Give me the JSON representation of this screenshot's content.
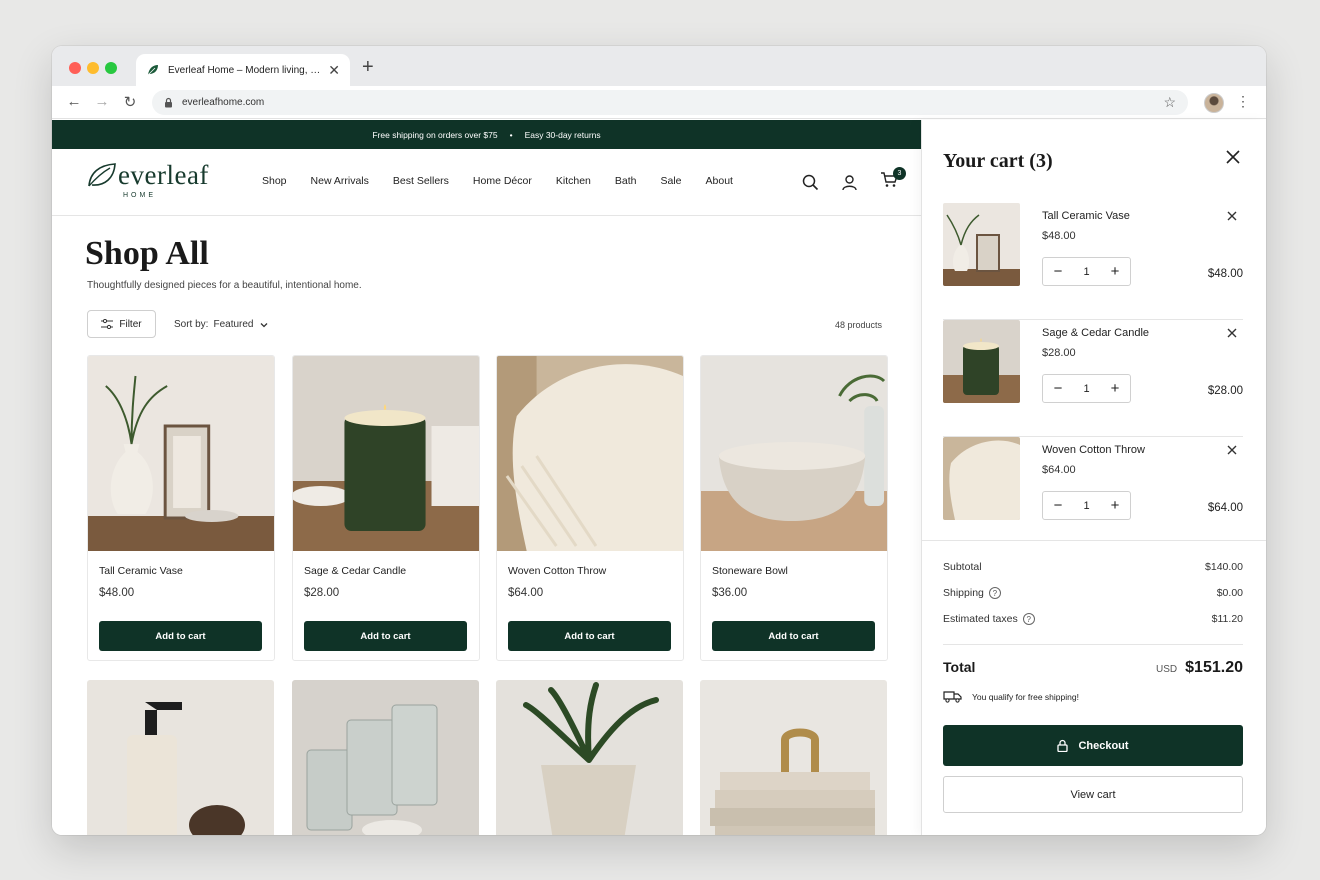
{
  "browser": {
    "tab_title": "Everleaf Home – Modern living, …",
    "url": "everleafhome.com",
    "icons": [
      "leaf-favicon",
      "close-icon",
      "plus-icon",
      "back-arrow-icon",
      "forward-arrow-icon",
      "reload-icon",
      "lock-icon",
      "star-icon",
      "avatar",
      "kebab-menu-icon"
    ]
  },
  "announcement": {
    "left": "Free shipping on orders over $75",
    "separator": "•",
    "right": "Easy 30-day returns"
  },
  "header": {
    "logo_word": "everleaf",
    "logo_sub": "HOME",
    "nav": [
      "Shop",
      "New Arrivals",
      "Best Sellers",
      "Home Décor",
      "Kitchen",
      "Bath",
      "Sale",
      "About"
    ],
    "cart_count": "3"
  },
  "catalog": {
    "title": "Shop All",
    "subtitle": "Thoughtfully designed pieces for a beautiful, intentional home.",
    "filter_label": "Filter",
    "sort_label": "Sort by:",
    "sort_value": "Featured",
    "product_count": "48 products",
    "add_label": "Add to cart",
    "products": [
      {
        "name": "Tall Ceramic Vase",
        "price": "$48.00"
      },
      {
        "name": "Sage & Cedar Candle",
        "price": "$28.00"
      },
      {
        "name": "Woven Cotton Throw",
        "price": "$64.00"
      },
      {
        "name": "Stoneware Bowl",
        "price": "$36.00"
      }
    ]
  },
  "cart": {
    "title": "Your cart (3)",
    "items": [
      {
        "name": "Tall Ceramic Vase",
        "price": "$48.00",
        "qty": "1",
        "line_total": "$48.00"
      },
      {
        "name": "Sage & Cedar Candle",
        "price": "$28.00",
        "qty": "1",
        "line_total": "$28.00"
      },
      {
        "name": "Woven Cotton Throw",
        "price": "$64.00",
        "qty": "1",
        "line_total": "$64.00"
      }
    ],
    "qty_minus": "−",
    "qty_plus": "+",
    "subtotal_label": "Subtotal",
    "subtotal": "$140.00",
    "shipping_label": "Shipping",
    "shipping": "$0.00",
    "taxes_label": "Estimated taxes",
    "taxes": "$11.20",
    "total_label": "Total",
    "currency": "USD",
    "total": "$151.20",
    "free_shipping_note": "You qualify for free shipping!",
    "checkout_label": "Checkout",
    "view_cart_label": "View cart"
  },
  "colors": {
    "brand_green": "#0f3327",
    "logo_green": "#173a2d"
  }
}
